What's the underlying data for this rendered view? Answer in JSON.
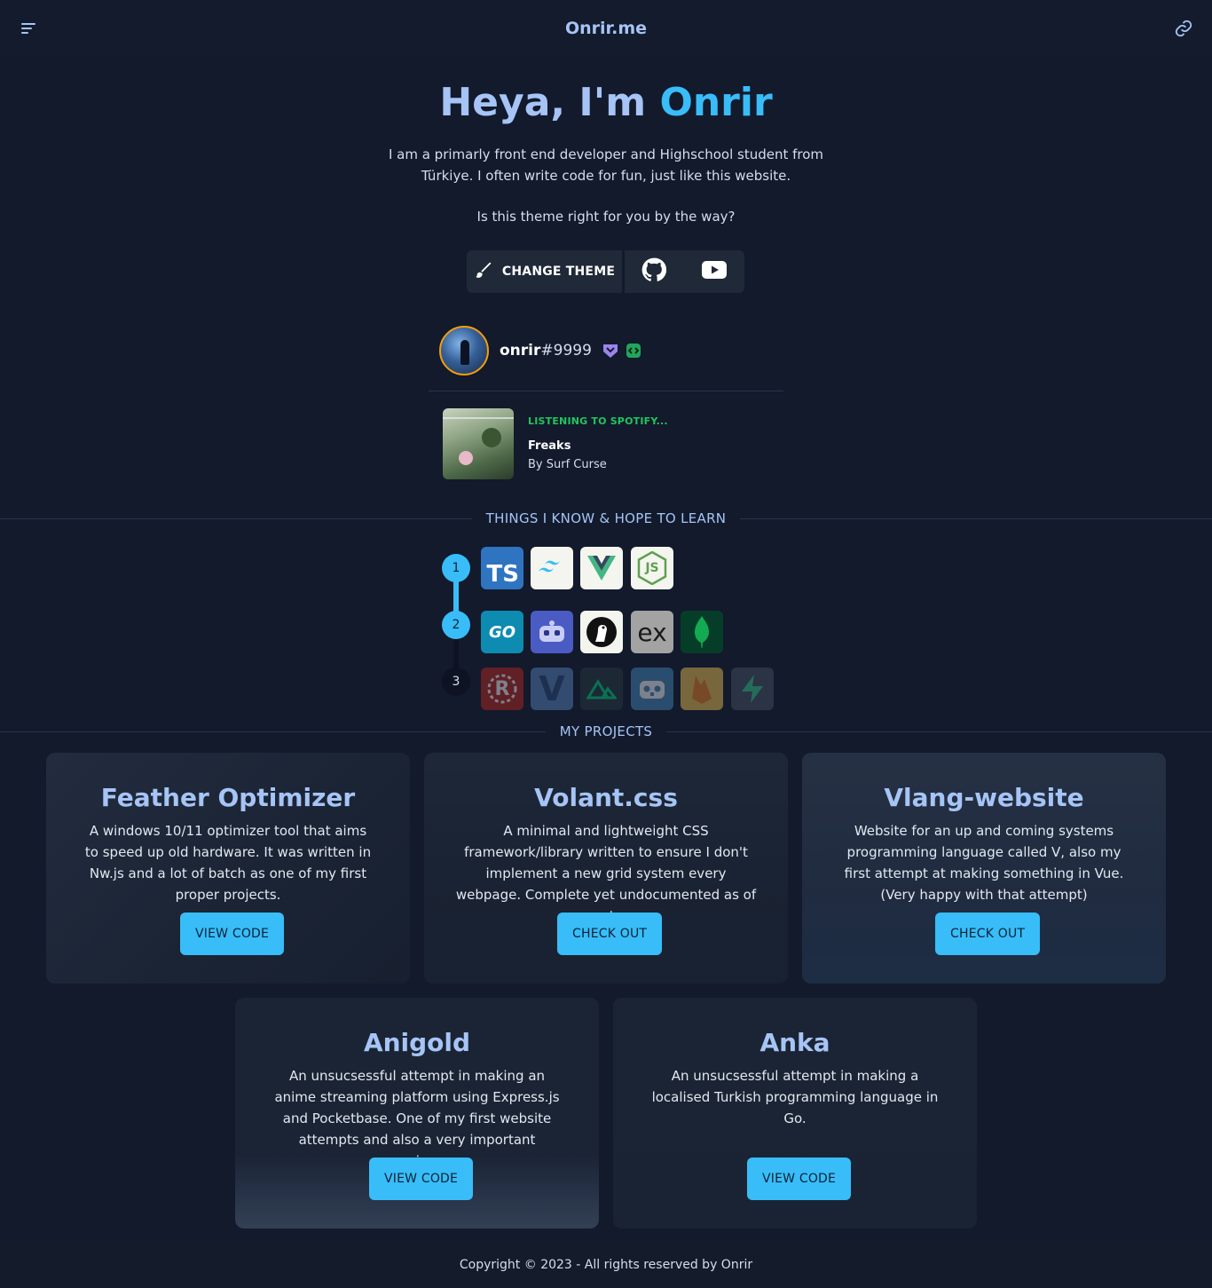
{
  "nav": {
    "brand": "Onrir.me",
    "menu_icon": "menu-icon",
    "link_icon": "link-icon"
  },
  "hero": {
    "greeting": "Heya, I'm ",
    "name": "Onrir",
    "description": "I am a primarly front end developer and Highschool student from Türkiye. I often write code for fun, just like this website.",
    "question": "Is this theme right for you by the way?",
    "change_theme_label": "CHANGE THEME",
    "github_icon": "github-icon",
    "youtube_icon": "youtube-icon"
  },
  "discord": {
    "username": "onrir",
    "discriminator": "#9999",
    "badges": [
      "hypesquad-badge-icon",
      "active-developer-badge-icon"
    ]
  },
  "spotify": {
    "status": "LISTENING TO SPOTIFY...",
    "song": "Freaks",
    "artist": "By Surf Curse"
  },
  "skills": {
    "heading": "THINGS I KNOW & HOPE TO LEARN",
    "steps": [
      "1",
      "2",
      "3"
    ],
    "row1": [
      {
        "icon": "typescript-icon",
        "label": "TS"
      },
      {
        "icon": "tailwind-icon",
        "label": ""
      },
      {
        "icon": "vue-icon",
        "label": ""
      },
      {
        "icon": "nodejs-icon",
        "label": "JS"
      }
    ],
    "row2": [
      {
        "icon": "go-icon",
        "label": "GO"
      },
      {
        "icon": "discord-bot-icon",
        "label": ""
      },
      {
        "icon": "deno-icon",
        "label": ""
      },
      {
        "icon": "express-icon",
        "label": "ex"
      },
      {
        "icon": "mongodb-icon",
        "label": ""
      }
    ],
    "row3": [
      {
        "icon": "rust-icon",
        "label": "R"
      },
      {
        "icon": "vlang-icon",
        "label": "V"
      },
      {
        "icon": "nuxt-icon",
        "label": ""
      },
      {
        "icon": "godot-icon",
        "label": ""
      },
      {
        "icon": "firebase-icon",
        "label": ""
      },
      {
        "icon": "supabase-icon",
        "label": ""
      }
    ]
  },
  "projects": {
    "heading": "MY PROJECTS",
    "items": [
      {
        "title": "Feather Optimizer",
        "description": "A windows 10/11 optimizer tool that aims to speed up old hardware. It was written in Nw.js and a lot of batch as one of my first proper projects.",
        "button": "VIEW CODE"
      },
      {
        "title": "Volant.css",
        "description": "A minimal and lightweight CSS framework/library written to ensure I don't implement a new grid system every webpage. Complete yet undocumented as of yet.",
        "button": "CHECK OUT"
      },
      {
        "title": "Vlang-website",
        "description": "Website for an up and coming systems programming language called V, also my first attempt at making something in Vue. (Very happy with that attempt)",
        "button": "CHECK OUT"
      },
      {
        "title": "Anigold",
        "description": "An unsucsessful attempt in making an anime streaming platform using Express.js and Pocketbase. One of my first website attempts and also a very important experience.",
        "button": "VIEW CODE"
      },
      {
        "title": "Anka",
        "description": "An unsucsessful attempt in making a localised Turkish programming language in Go.",
        "button": "VIEW CODE"
      }
    ]
  },
  "footer": {
    "text": "Copyright © 2023 - All rights reserved by Onrir"
  }
}
